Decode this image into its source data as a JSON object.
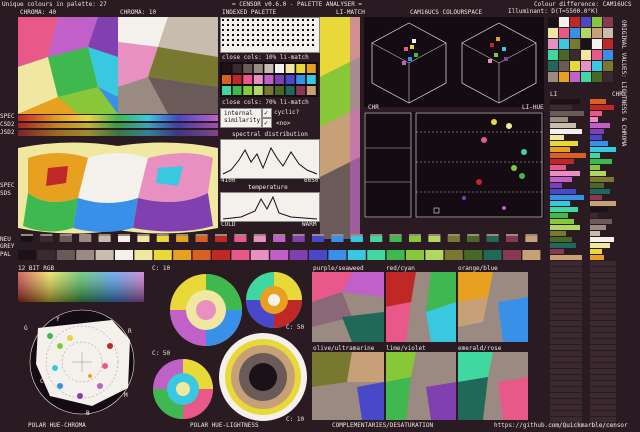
{
  "header": {
    "unique_colours": "Unique colours in palette: 27",
    "app_title": "= CENSOR v0.6.0 - PALETTE ANALYSER =",
    "colour_difference": "Colour difference: CAM16UCS",
    "illuminant": "Illuminant: D(T=5500.0°K)"
  },
  "top_panels": {
    "chroma40": "CHROMA: 40",
    "chroma10": "CHROMA: 10",
    "indexed_palette": "INDEXED PALETTE",
    "li_match": "LI-MATCH",
    "cam16ucs": "CAM16UCS COLOURSPACE",
    "chr": "CHR",
    "li_hue": "LI-HUE",
    "li": "LI",
    "chr_right": "CHR"
  },
  "indexed": {
    "close_cols_10": "close cols: 10% li-match",
    "close_cols_70": "close cols: 70% li-match",
    "internal_similarity": "internal similarity",
    "cyclic": "cyclic?",
    "no": "<no>",
    "spectral_distribution": "spectral distribution",
    "spec_min": "4100",
    "spec_max": "6650",
    "temperature": "temperature",
    "cold": "COLD",
    "warm": "WARM"
  },
  "side_labels": {
    "spec": "SPEC",
    "csd2": "CSD2",
    "jsd2": "JSD2",
    "spec2": "SPEC",
    "sds": "SDS",
    "neu": "NEU",
    "grey": "GREY",
    "pal": "PAL",
    "vertical_right": "ORIGINAL VALUES: LIGHTNESS & CHROMA"
  },
  "bottom": {
    "rgb12": "12 BIT RGB",
    "c10_a": "C: 10",
    "c50_a": "C: 50",
    "c50_b": "C: 50",
    "c10_b": "C: 10",
    "polar_hue_chroma": "POLAR HUE-CHROMA",
    "polar_hue_lightness": "POLAR HUE-LIGHTNESS",
    "complementaries": "COMPLEMENTARIES/DESATURATION",
    "github": "https://github.com/Quickmarble/censor",
    "pair_purple": "purple/seaweed",
    "pair_red": "red/cyan",
    "pair_orange": "orange/blue",
    "pair_olive": "olive/ultramarine",
    "pair_lime": "lime/violet",
    "pair_emerald": "emerald/rose",
    "polar_letters": [
      "G",
      "Y",
      "R",
      "C",
      "M",
      "B"
    ]
  },
  "palette": [
    "#1a1218",
    "#3a2a30",
    "#6a5a58",
    "#9a8a82",
    "#c8bcae",
    "#f4f0ec",
    "#f0e8a0",
    "#e8d838",
    "#e8a020",
    "#d86020",
    "#c02828",
    "#e85888",
    "#e890c0",
    "#c060c8",
    "#8040b0",
    "#4848c8",
    "#3890e8",
    "#38c8e0",
    "#40d8a0",
    "#40b850",
    "#88c838",
    "#b0d860",
    "#787830",
    "#486828",
    "#206858",
    "#883850",
    "#c8a078"
  ],
  "colors": {
    "background": "#2a1a22",
    "panel": "#140c12",
    "text": "#f0e8e0"
  }
}
